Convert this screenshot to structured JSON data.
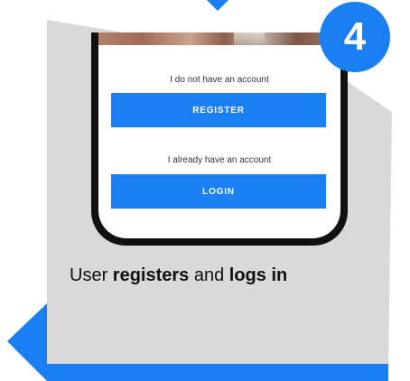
{
  "screen": {
    "register_prompt": "I do not have an account",
    "register_label": "REGISTER",
    "login_prompt": "I already have an account",
    "login_label": "LOGIN"
  },
  "step": {
    "number": "4"
  },
  "tagline": {
    "prefix": "User ",
    "word1": "registers",
    "middle": " and ",
    "word2": "logs in"
  },
  "colors": {
    "accent": "#1a7ff2",
    "panel": "#d9d9d9",
    "phone_frame": "#111111"
  }
}
